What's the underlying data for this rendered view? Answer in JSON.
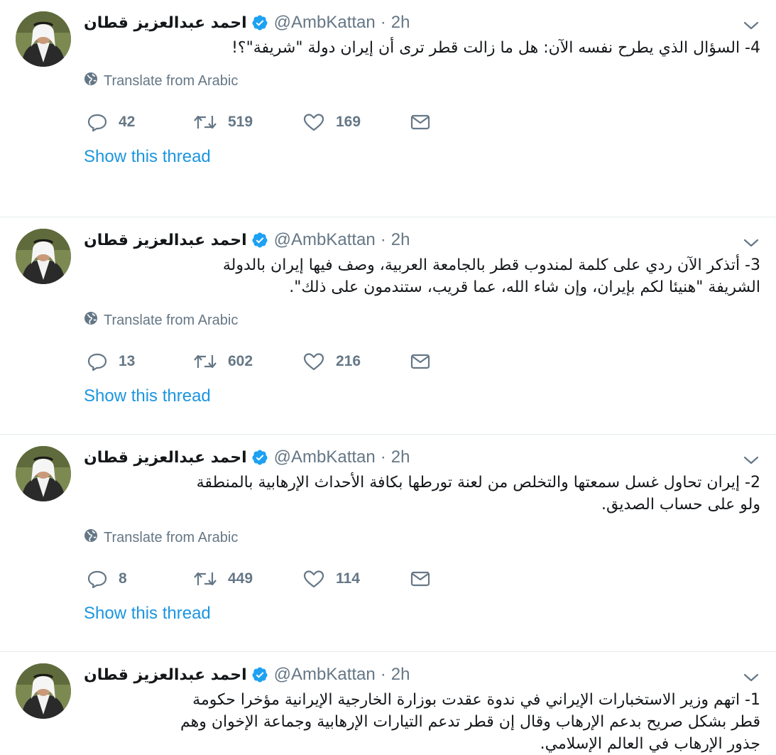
{
  "colors": {
    "link": "#1b95e0",
    "muted": "#657786",
    "verified": "#1da1f2",
    "divider": "#e6ecf0"
  },
  "icons": {
    "verified": "verified-badge-icon",
    "globe": "globe-icon",
    "reply": "reply-icon",
    "retweet": "retweet-icon",
    "like": "heart-icon",
    "dm": "envelope-icon",
    "caret": "chevron-down-icon"
  },
  "tweets": [
    {
      "name": "احمد عبدالعزيز قطان",
      "handle": "@AmbKattan",
      "separator": "·",
      "time": "2h",
      "lines": [
        "4- السؤال الذي يطرح نفسه الآن: هل ما زالت قطر ترى أن إيران دولة \"شريفة\"؟!"
      ],
      "translate": "Translate from Arabic",
      "replies": "42",
      "retweets": "519",
      "likes": "169",
      "show_thread": "Show this thread"
    },
    {
      "name": "احمد عبدالعزيز قطان",
      "handle": "@AmbKattan",
      "separator": "·",
      "time": "2h",
      "lines": [
        "3- أتذكر الآن ردي على كلمة لمندوب قطر بالجامعة العربية، وصف فيها إيران بالدولة",
        "الشريفة \"هنيئا لكم بإيران، وإن شاء الله، عما قريب، ستندمون على ذلك\"."
      ],
      "translate": "Translate from Arabic",
      "replies": "13",
      "retweets": "602",
      "likes": "216",
      "show_thread": "Show this thread"
    },
    {
      "name": "احمد عبدالعزيز قطان",
      "handle": "@AmbKattan",
      "separator": "·",
      "time": "2h",
      "lines": [
        "2- إيران تحاول غسل سمعتها والتخلص من لعنة تورطها بكافة الأحداث الإرهابية بالمنطقة",
        "ولو على حساب الصديق."
      ],
      "translate": "Translate from Arabic",
      "replies": "8",
      "retweets": "449",
      "likes": "114",
      "show_thread": "Show this thread"
    },
    {
      "name": "احمد عبدالعزيز قطان",
      "handle": "@AmbKattan",
      "separator": "·",
      "time": "2h",
      "lines": [
        "1- اتهم وزير الاستخبارات الإيراني في ندوة عقدت بوزارة الخارجية الإيرانية مؤخرا حكومة",
        "قطر بشكل صريح بدعم الإرهاب وقال إن قطر تدعم التيارات الإرهابية وجماعة الإخوان وهم",
        "جذور الإرهاب في العالم الإسلامي."
      ]
    }
  ]
}
